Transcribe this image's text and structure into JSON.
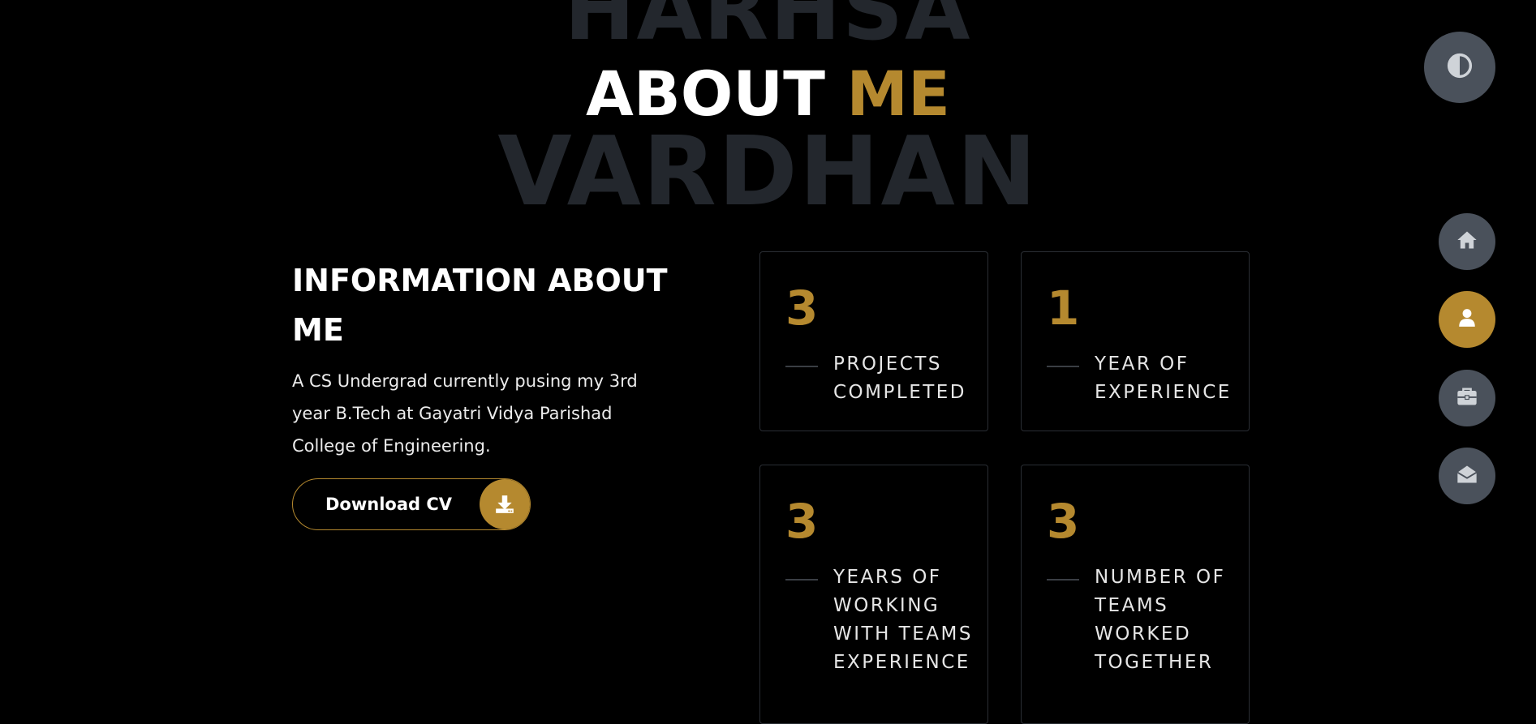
{
  "background_words": {
    "top": "HARHSA",
    "bottom": "VARDHAN"
  },
  "heading": {
    "main": "ABOUT",
    "accent": "ME"
  },
  "info": {
    "title": "INFORMATION ABOUT ME",
    "description": "A CS Undergrad currently pusing my 3rd year B.Tech at Gayatri Vidya Parishad College of Engineering.",
    "download_label": "Download CV",
    "download_icon": "download-icon"
  },
  "stats": [
    {
      "number": "3",
      "label": "Projects completed"
    },
    {
      "number": "1",
      "label": "Year of experience"
    },
    {
      "number": "3",
      "label": "Years of working with teams experience"
    },
    {
      "number": "3",
      "label": "Number of teams worked together"
    }
  ],
  "side_nav": {
    "theme_toggle_icon": "contrast-icon",
    "items": [
      {
        "icon": "home-icon",
        "active": false
      },
      {
        "icon": "user-icon",
        "active": true
      },
      {
        "icon": "briefcase-icon",
        "active": false
      },
      {
        "icon": "envelope-open-icon",
        "active": false
      }
    ]
  },
  "colors": {
    "background": "#000000",
    "accent": "#b5892f",
    "ghost_text": "#23272d",
    "nav_button": "#4a515b"
  }
}
